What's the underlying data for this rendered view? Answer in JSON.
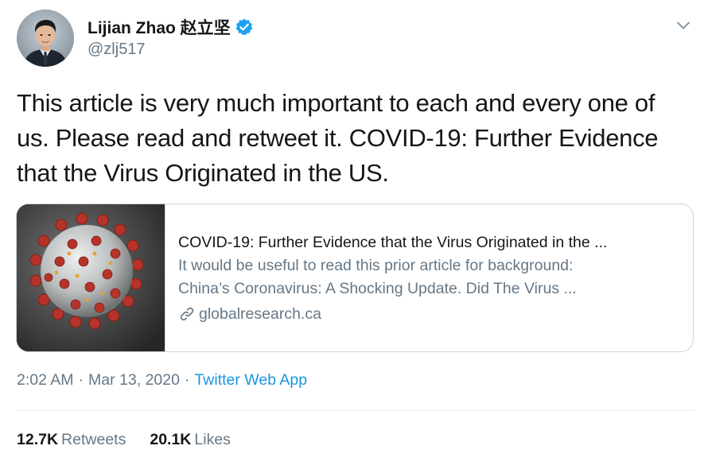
{
  "author": {
    "display_name": "Lijian Zhao 赵立坚",
    "handle": "@zlj517",
    "verified_icon": "verified-badge-icon",
    "avatar_icon": "profile-photo"
  },
  "tweet": {
    "text": "This article is very much important to each and every one of us. Please read and retweet it. COVID-19: Further Evidence that the Virus Originated in the US."
  },
  "card": {
    "title": "COVID-19: Further Evidence that the Virus Originated in the ...",
    "description_line1": "It would be useful to read this prior article for background:",
    "description_line2": "China’s Coronavirus: A Shocking Update. Did The Virus ...",
    "domain": "globalresearch.ca",
    "image_icon": "coronavirus-image"
  },
  "meta": {
    "time": "2:02 AM",
    "separator1": "·",
    "date": "Mar 13, 2020",
    "separator2": "·",
    "source": "Twitter Web App"
  },
  "stats": {
    "retweets_count": "12.7K",
    "retweets_label": "Retweets",
    "likes_count": "20.1K",
    "likes_label": "Likes"
  },
  "colors": {
    "text_primary": "#14171a",
    "text_secondary": "#657786",
    "link_blue": "#1b95e0",
    "verified_blue": "#1da1f2",
    "border": "#ccd6dd"
  }
}
